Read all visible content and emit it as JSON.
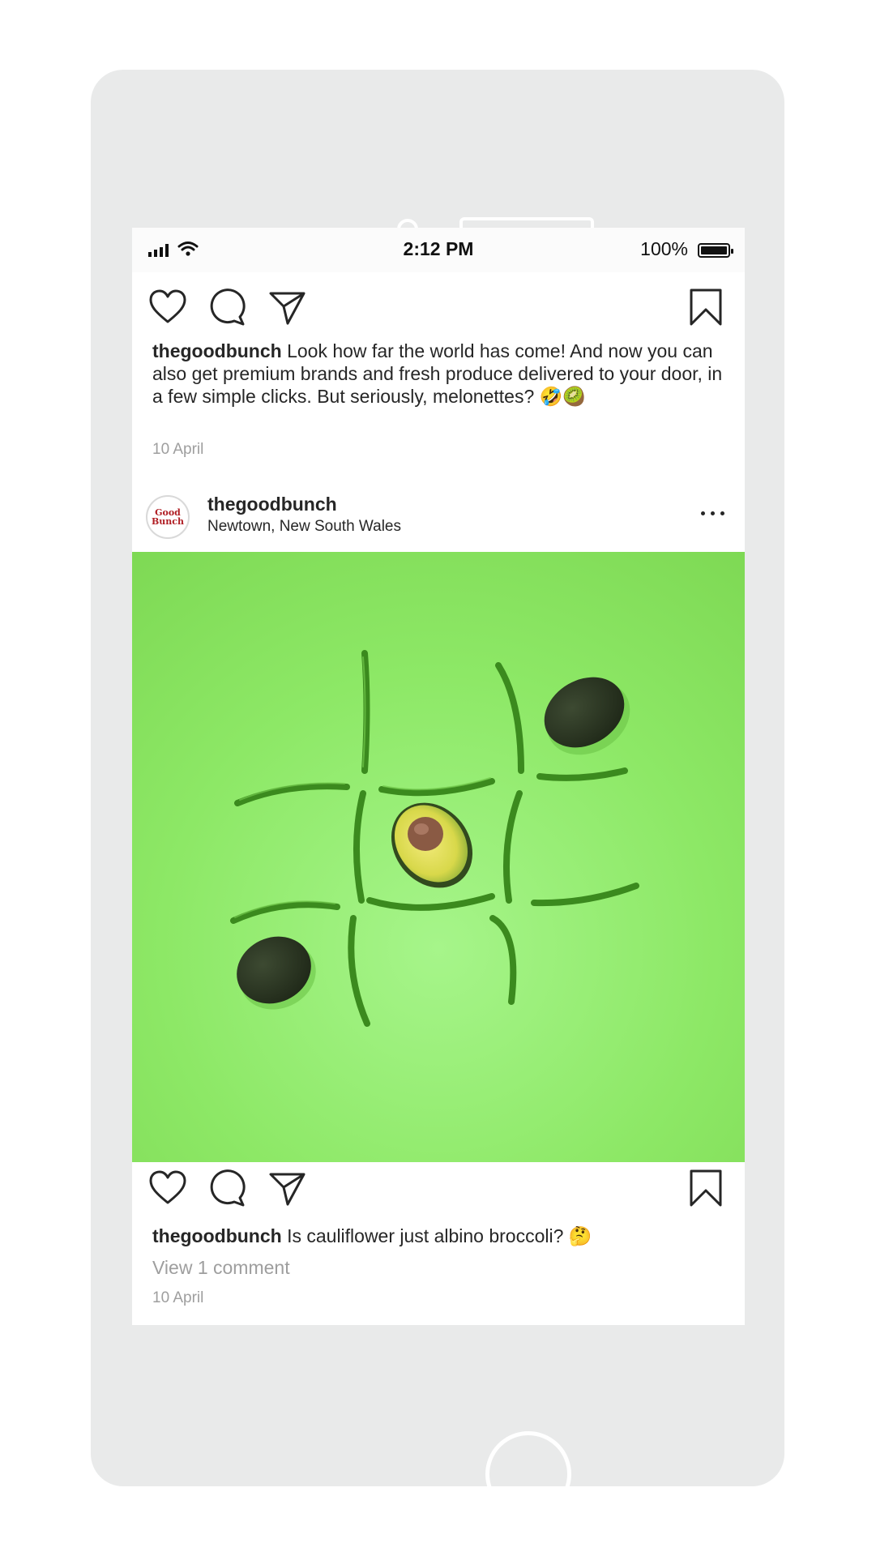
{
  "status_bar": {
    "time": "2:12 PM",
    "battery": "100%"
  },
  "icons": {
    "like": "heart-outline",
    "comment": "speech-bubble-outline",
    "share": "paper-plane-outline",
    "save": "bookmark-outline",
    "more": "ellipsis-horizontal",
    "signal": "cellular-signal",
    "wifi": "wifi",
    "battery": "battery-full"
  },
  "post1": {
    "username": "thegoodbunch",
    "caption": " Look how far the world has come! And now you can also get premium brands and fresh produce delivered to your door, in a few simple clicks. But seriously, melonettes? 🤣🥝",
    "date": "10 April"
  },
  "post2": {
    "username": "thegoodbunch",
    "location": "Newtown, New South Wales",
    "avatar_text": [
      "Good",
      "Bunch"
    ],
    "photo": "green background tic-tac-toe of green beans with avocados",
    "caption": " Is cauliflower just albino broccoli? 🤔",
    "view_comments": "View 1 comment",
    "date": "10 April"
  },
  "colors": {
    "phone_body": "#e9eaea",
    "text": "#262626",
    "muted": "#9e9e9e",
    "avatar_brand": "#b01e24",
    "photo_green": "#8de866"
  }
}
